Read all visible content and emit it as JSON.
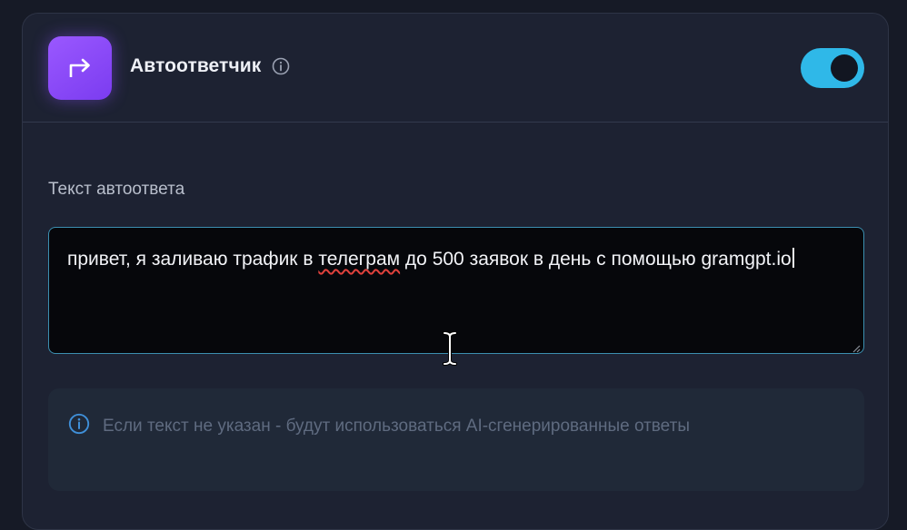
{
  "autoresponder": {
    "title": "Автоответчик",
    "enabled": true,
    "accent_color": "#2fb8e8",
    "icon_gradient": [
      "#9a58ff",
      "#7b3cf0"
    ]
  },
  "reply_field": {
    "label": "Текст автоответа",
    "value_before": "привет, я заливаю трафик в ",
    "value_misspelled": "телеграм",
    "value_after": " до 500 заявок в день с помощью gramgpt.io"
  },
  "notice": {
    "text": "Если текст не указан - будут использоваться AI-сгенерированные ответы"
  }
}
